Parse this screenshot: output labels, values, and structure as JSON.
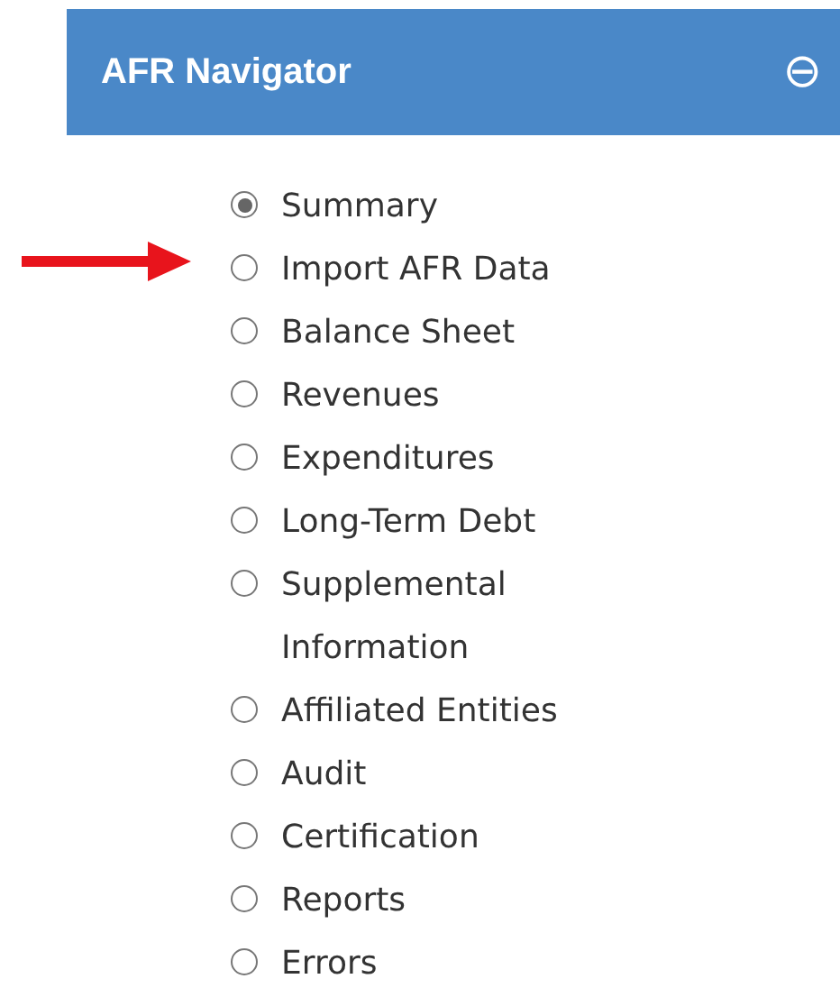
{
  "panel": {
    "title": "AFR Navigator",
    "collapse_icon": "⊖"
  },
  "items": [
    {
      "label": "Summary",
      "selected": true
    },
    {
      "label": "Import AFR Data",
      "selected": false
    },
    {
      "label": "Balance Sheet",
      "selected": false
    },
    {
      "label": "Revenues",
      "selected": false
    },
    {
      "label": "Expenditures",
      "selected": false
    },
    {
      "label": "Long-Term Debt",
      "selected": false
    },
    {
      "label": "Supplemental Information",
      "selected": false
    },
    {
      "label": "Affiliated Entities",
      "selected": false
    },
    {
      "label": "Audit",
      "selected": false
    },
    {
      "label": "Certification",
      "selected": false
    },
    {
      "label": "Reports",
      "selected": false
    },
    {
      "label": "Errors",
      "selected": false
    }
  ]
}
